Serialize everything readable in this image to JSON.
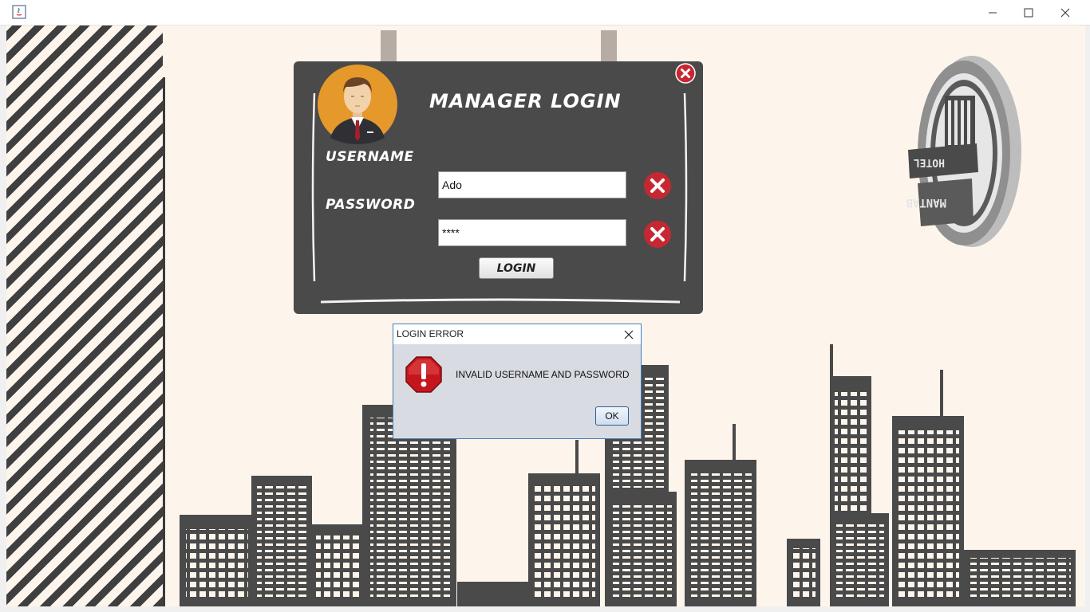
{
  "window": {
    "title": "",
    "controls": [
      "minimize-icon",
      "maximize-icon",
      "close-icon"
    ]
  },
  "login_panel": {
    "title": "MANAGER LOGIN",
    "username_label": "USERNAME",
    "username_value": "Ado",
    "password_label": "PASSWORD",
    "password_value": "****",
    "login_button": "LOGIN"
  },
  "badge": {
    "text_top": "HOTEL",
    "text_bottom": "MANTAB"
  },
  "dialog": {
    "title": "LOGIN ERROR",
    "message": "INVALID USERNAME AND PASSWORD",
    "ok_label": "OK",
    "icon": "error-stop-icon"
  },
  "colors": {
    "panel": "#4a4a4a",
    "background": "#fdf5ec",
    "clear_button": "#c62832",
    "skyline": "#4a4a4a"
  }
}
